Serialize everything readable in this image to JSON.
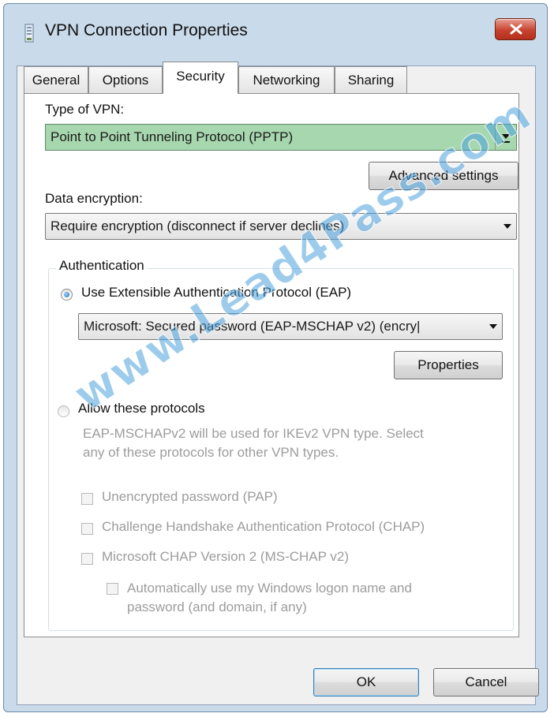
{
  "window": {
    "title": "VPN Connection Properties",
    "close_icon": "close-icon"
  },
  "tabs": [
    {
      "label": "General"
    },
    {
      "label": "Options"
    },
    {
      "label": "Security",
      "active": true
    },
    {
      "label": "Networking"
    },
    {
      "label": "Sharing"
    }
  ],
  "security": {
    "vpn_type_label": "Type of VPN:",
    "vpn_type_value": "Point to Point Tunneling Protocol (PPTP)",
    "advanced_settings_label": "Advanced settings",
    "data_encryption_label": "Data encryption:",
    "data_encryption_value": "Require encryption (disconnect if server declines)",
    "authentication": {
      "group_label": "Authentication",
      "eap_radio_label": "Use Extensible Authentication Protocol (EAP)",
      "eap_radio_checked": true,
      "eap_method_value": "Microsoft: Secured password (EAP-MSCHAP v2) (encry|",
      "properties_label": "Properties",
      "allow_protocols_label": "Allow these protocols",
      "allow_protocols_checked": false,
      "description_line1": "EAP-MSCHAPv2 will be used for IKEv2 VPN type. Select",
      "description_line2": "any of these protocols for other VPN types.",
      "protocols": [
        {
          "label": "Unencrypted password (PAP)",
          "checked": false
        },
        {
          "label": "Challenge Handshake Authentication Protocol (CHAP)",
          "checked": false
        },
        {
          "label": "Microsoft CHAP Version 2 (MS-CHAP v2)",
          "checked": false
        }
      ],
      "auto_logon_line1": "Automatically use my Windows logon name and",
      "auto_logon_line2": "password (and domain, if any)",
      "auto_logon_checked": false
    }
  },
  "buttons": {
    "ok_label": "OK",
    "cancel_label": "Cancel"
  },
  "watermark": "www.Lead4Pass.com",
  "colors": {
    "selected_combo_bg": "#a7d7ae",
    "close_button": "#c8432f",
    "watermark": "#4aa0dc"
  }
}
